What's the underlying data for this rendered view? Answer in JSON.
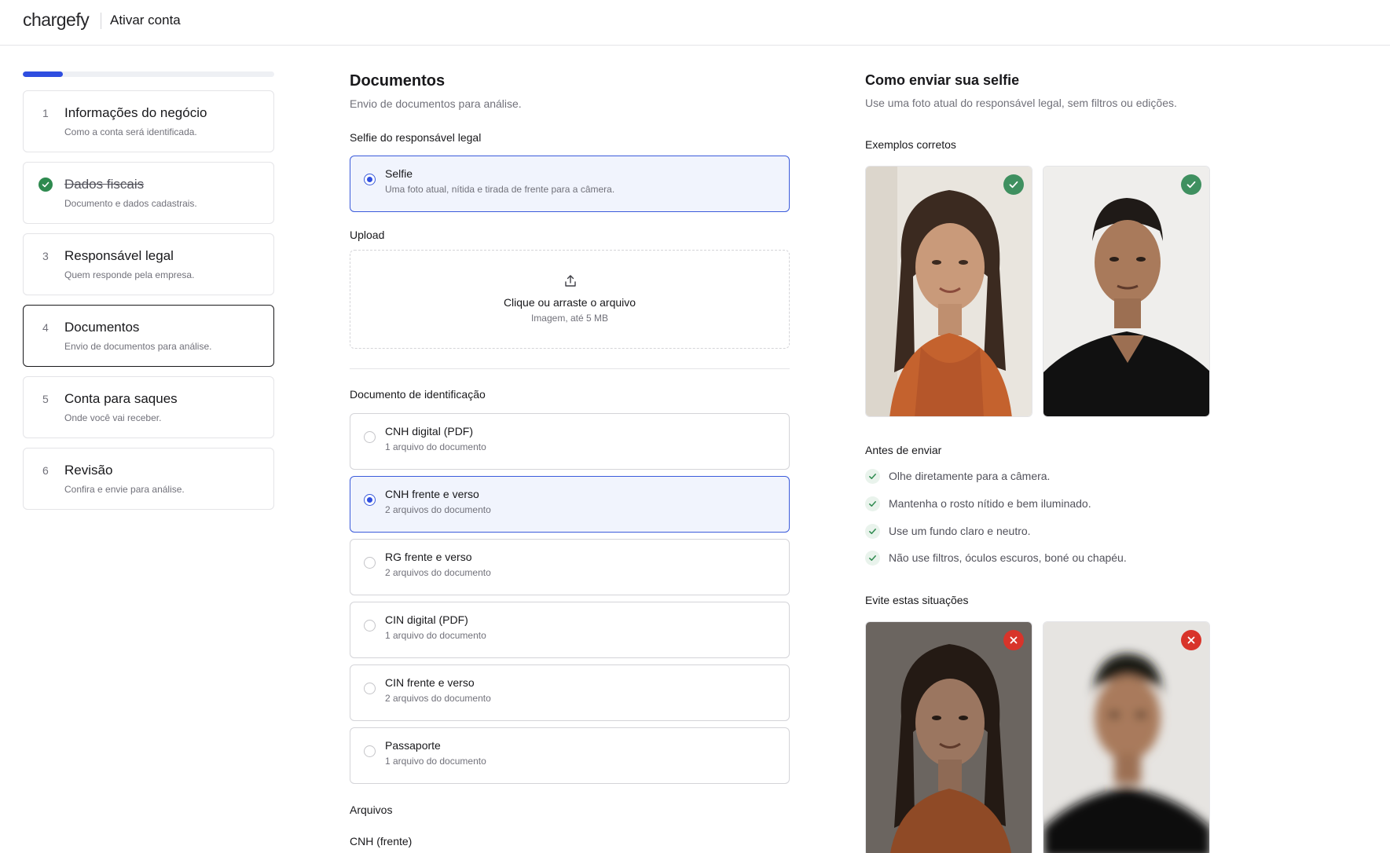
{
  "header": {
    "logo": "chargefy",
    "title": "Ativar conta"
  },
  "progress": {
    "current_step": 4,
    "total_steps": 6,
    "fraction": 0.16
  },
  "steps": [
    {
      "number": "1",
      "title": "Informações do negócio",
      "desc": "Como a conta será identificada.",
      "state": "default"
    },
    {
      "number": "2",
      "title": "Dados fiscais",
      "desc": "Documento e dados cadastrais.",
      "state": "completed"
    },
    {
      "number": "3",
      "title": "Responsável legal",
      "desc": "Quem responde pela empresa.",
      "state": "default"
    },
    {
      "number": "4",
      "title": "Documentos",
      "desc": "Envio de documentos para análise.",
      "state": "active"
    },
    {
      "number": "5",
      "title": "Conta para saques",
      "desc": "Onde você vai receber.",
      "state": "default"
    },
    {
      "number": "6",
      "title": "Revisão",
      "desc": "Confira e envie para análise.",
      "state": "default"
    }
  ],
  "main": {
    "title": "Documentos",
    "subtitle": "Envio de documentos para análise.",
    "selfie_section_label": "Selfie do responsável legal",
    "selfie_option": {
      "title": "Selfie",
      "desc": "Uma foto atual, nítida e tirada de frente para a câmera.",
      "selected": true
    },
    "upload_label": "Upload",
    "upload": {
      "title": "Clique ou arraste o arquivo",
      "desc": "Imagem, até 5 MB"
    },
    "id_section_label": "Documento de identificação",
    "id_options": [
      {
        "title": "CNH digital (PDF)",
        "desc": "1 arquivo do documento",
        "selected": false
      },
      {
        "title": "CNH frente e verso",
        "desc": "2 arquivos do documento",
        "selected": true
      },
      {
        "title": "RG frente e verso",
        "desc": "2 arquivos do documento",
        "selected": false
      },
      {
        "title": "CIN digital (PDF)",
        "desc": "1 arquivo do documento",
        "selected": false
      },
      {
        "title": "CIN frente e verso",
        "desc": "2 arquivos do documento",
        "selected": false
      },
      {
        "title": "Passaporte",
        "desc": "1 arquivo do documento",
        "selected": false
      }
    ],
    "files_label": "Arquivos",
    "file_item_label": "CNH (frente)"
  },
  "guide": {
    "title": "Como enviar sua selfie",
    "subtitle": "Use uma foto atual do responsável legal, sem filtros ou edições.",
    "good_label": "Exemplos corretos",
    "before_label": "Antes de enviar",
    "tips": [
      "Olhe diretamente para a câmera.",
      "Mantenha o rosto nítido e bem iluminado.",
      "Use um fundo claro e neutro.",
      "Não use filtros, óculos escuros, boné ou chapéu."
    ],
    "avoid_label": "Evite estas situações"
  },
  "colors": {
    "accent": "#2f4ee0",
    "success": "#3f9060",
    "danger": "#d8342a"
  }
}
